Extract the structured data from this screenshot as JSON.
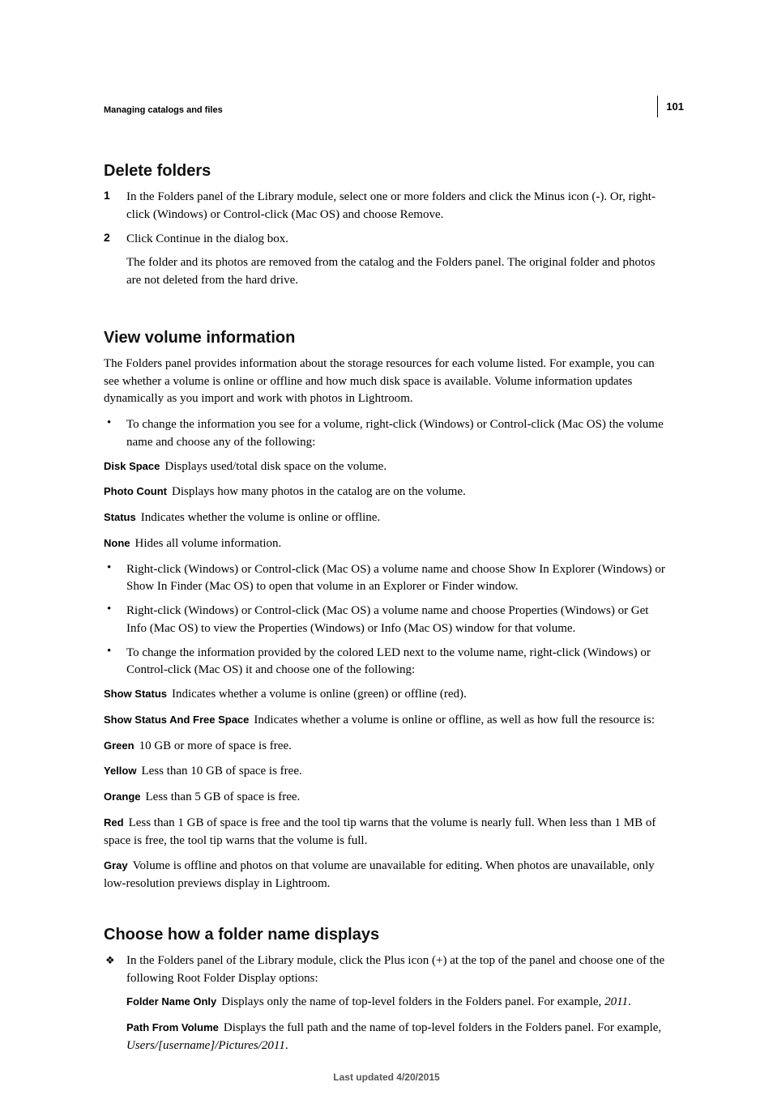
{
  "page": {
    "number": "101",
    "section": "Managing catalogs and files",
    "footer": "Last updated 4/20/2015"
  },
  "delete_folders": {
    "heading": "Delete folders",
    "step1": "In the Folders panel of the Library module, select one or more folders and click the Minus icon (-). Or, right-click (Windows) or Control-click (Mac OS) and choose Remove.",
    "step2": "Click Continue in the dialog box.",
    "step2_sub": "The folder and its photos are removed from the catalog and the Folders panel. The original folder and photos are not deleted from the hard drive.",
    "markers": {
      "one": "1",
      "two": "2"
    }
  },
  "view_volume": {
    "heading": "View volume information",
    "intro": "The Folders panel provides information about the storage resources for each volume listed. For example, you can see whether a volume is online or offline and how much disk space is available. Volume information updates dynamically as you import and work with photos in Lightroom.",
    "bullet1": "To change the information you see for a volume, right-click (Windows) or Control-click (Mac OS) the volume name and choose any of the following:",
    "terms1": [
      {
        "term": "Disk Space",
        "def": "Displays used/total disk space on the volume."
      },
      {
        "term": "Photo Count",
        "def": "Displays how many photos in the catalog are on the volume."
      },
      {
        "term": "Status",
        "def": "Indicates whether the volume is online or offline."
      },
      {
        "term": "None",
        "def": "Hides all volume information."
      }
    ],
    "bullet2": "Right-click (Windows) or Control-click (Mac OS) a volume name and choose Show In Explorer (Windows) or Show In Finder (Mac OS) to open that volume in an Explorer or Finder window.",
    "bullet3": "Right-click (Windows) or Control-click (Mac OS) a volume name and choose Properties (Windows) or Get Info (Mac OS) to view the Properties (Windows) or Info (Mac OS) window for that volume.",
    "bullet4": "To change the information provided by the colored LED next to the volume name, right-click (Windows) or Control-click (Mac OS) it and choose one of the following:",
    "terms2": [
      {
        "term": "Show Status",
        "def": "Indicates whether a volume is online (green) or offline (red)."
      },
      {
        "term": "Show Status And Free Space",
        "def": "Indicates whether a volume is online or offline, as well as how full the resource is:"
      },
      {
        "term": "Green",
        "def": "10 GB or more of space is free."
      },
      {
        "term": "Yellow",
        "def": "Less than 10 GB of space is free."
      },
      {
        "term": "Orange",
        "def": "Less than 5 GB of space is free."
      },
      {
        "term": "Red",
        "def": "Less than 1 GB of space is free and the tool tip warns that the volume is nearly full. When less than 1 MB of space is free, the tool tip warns that the volume is full."
      },
      {
        "term": "Gray",
        "def": "Volume is offline and photos on that volume are unavailable for editing. When photos are unavailable, only low-resolution previews display in Lightroom."
      }
    ]
  },
  "folder_name_display": {
    "heading": "Choose how a folder name displays",
    "diamond": "In the Folders panel of the Library module, click the Plus icon (+) at the top of the panel and choose one of the following Root Folder Display options:",
    "opt1_term": "Folder Name Only",
    "opt1_def_pre": "Displays only the name of top-level folders in the Folders panel. For example, ",
    "opt1_path": "2011",
    "opt1_def_post": ".",
    "opt2_term": "Path From Volume",
    "opt2_def_pre": "Displays the full path and the name of top-level folders in the Folders panel. For example, ",
    "opt2_path": "Users/[username]/Pictures/2011",
    "opt2_def_post": "."
  },
  "markers": {
    "bullet": "•",
    "diamond": "❖"
  }
}
